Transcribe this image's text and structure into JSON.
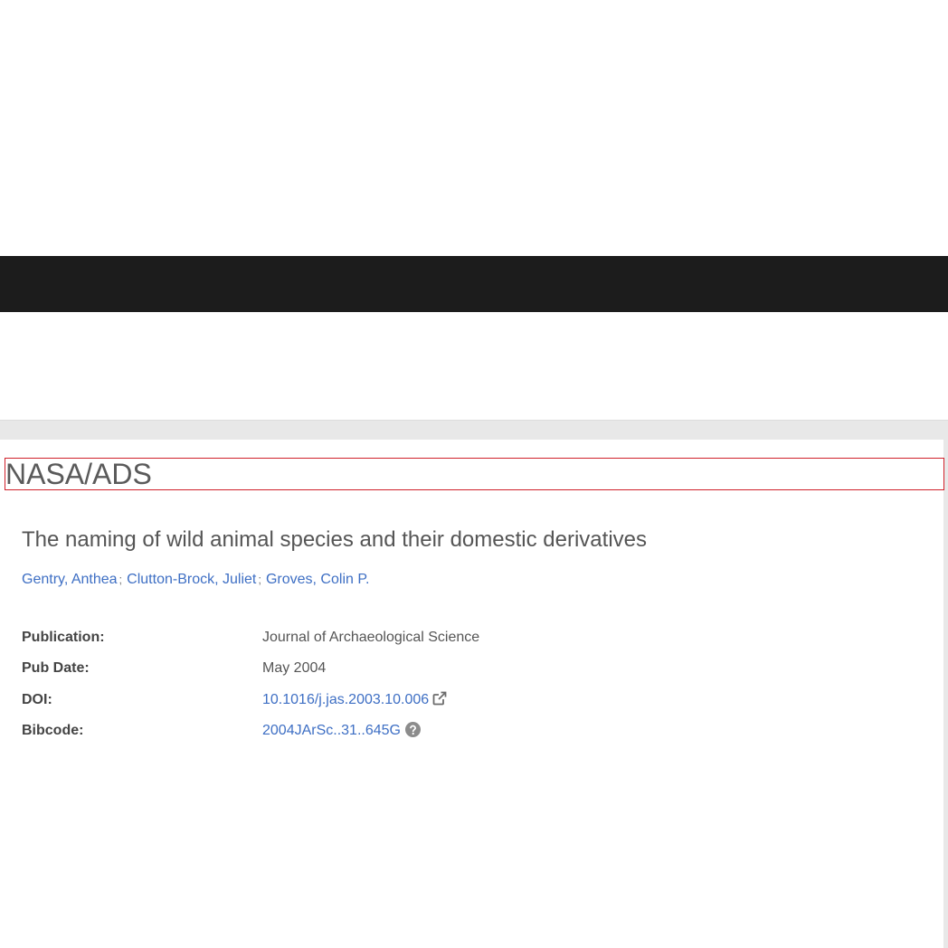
{
  "header": {
    "site_title": "NASA/ADS"
  },
  "article": {
    "title": "The naming of wild animal species and their domestic derivatives",
    "authors": [
      "Gentry, Anthea",
      "Clutton-Brock, Juliet",
      "Groves, Colin P."
    ],
    "author_separator": ";"
  },
  "metadata": {
    "publication_label": "Publication:",
    "publication_value": "Journal of Archaeological Science",
    "pubdate_label": "Pub Date:",
    "pubdate_value": "May 2004",
    "doi_label": "DOI:",
    "doi_value": "10.1016/j.jas.2003.10.006",
    "doi_icon": "external-link-icon",
    "bibcode_label": "Bibcode:",
    "bibcode_value": "2004JArSc..31..645G",
    "bibcode_icon": "question-circle-icon"
  },
  "colors": {
    "navbar": "#1c1c1c",
    "link": "#3e6fc4",
    "highlight_border": "#d0202a",
    "background_gray": "#e8e8e8"
  }
}
